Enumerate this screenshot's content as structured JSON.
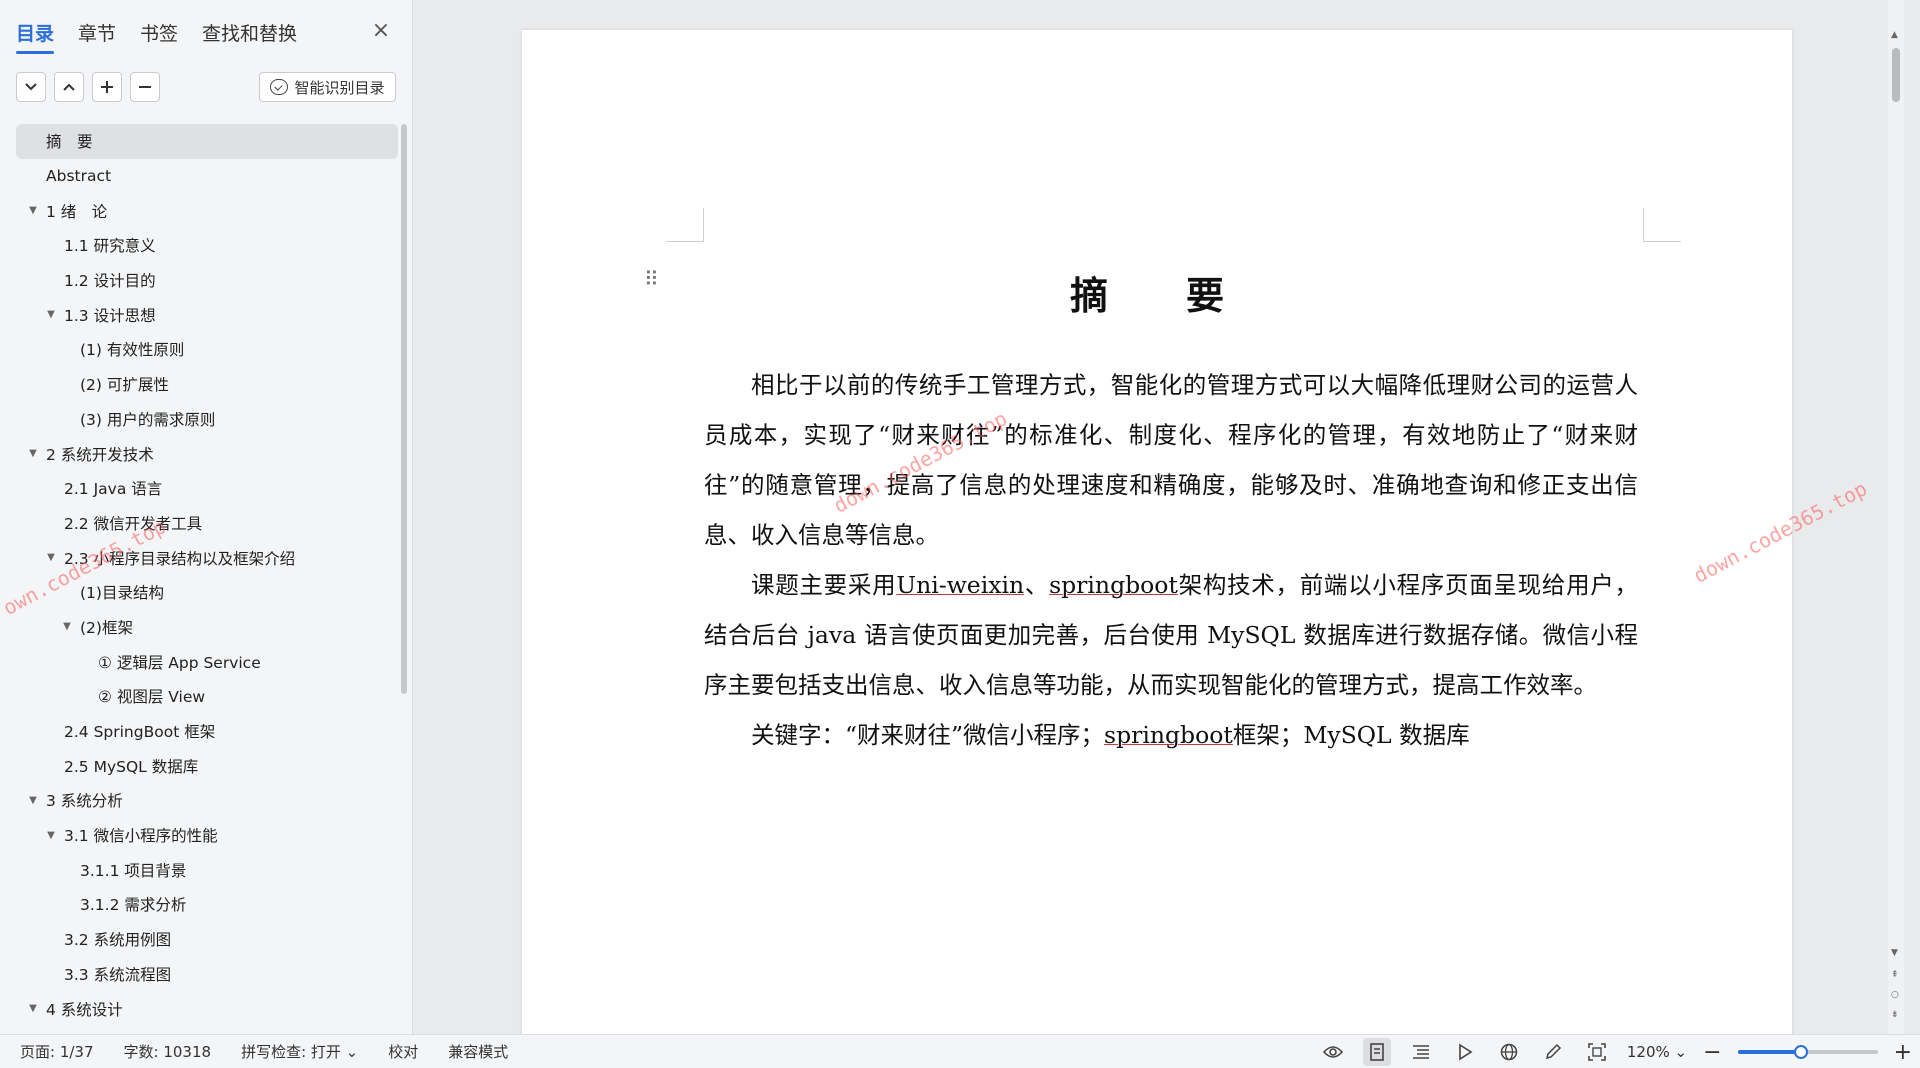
{
  "sidebar": {
    "tabs": [
      {
        "label": "目录",
        "active": true
      },
      {
        "label": "章节",
        "active": false
      },
      {
        "label": "书签",
        "active": false
      },
      {
        "label": "查找和替换",
        "active": false
      }
    ],
    "close_label": "×",
    "smart_button_label": "智能识别目录",
    "toc": [
      {
        "label": "摘　要",
        "level": 1,
        "arrow": "",
        "selected": true
      },
      {
        "label": "Abstract",
        "level": 1,
        "arrow": ""
      },
      {
        "label": "1 绪　论",
        "level": 1,
        "arrow": "▼"
      },
      {
        "label": "1.1 研究意义",
        "level": 2,
        "arrow": ""
      },
      {
        "label": "1.2 设计目的",
        "level": 2,
        "arrow": ""
      },
      {
        "label": "1.3 设计思想",
        "level": 2,
        "arrow": "▼"
      },
      {
        "label": "(1)  有效性原则",
        "level": 3,
        "arrow": ""
      },
      {
        "label": "(2)  可扩展性",
        "level": 3,
        "arrow": ""
      },
      {
        "label": "(3)  用户的需求原则",
        "level": 3,
        "arrow": ""
      },
      {
        "label": "2 系统开发技术",
        "level": 1,
        "arrow": "▼"
      },
      {
        "label": "2.1 Java 语言",
        "level": 2,
        "arrow": ""
      },
      {
        "label": "2.2 微信开发者工具",
        "level": 2,
        "arrow": ""
      },
      {
        "label": "2.3 小程序目录结构以及框架介绍",
        "level": 2,
        "arrow": "▼"
      },
      {
        "label": "(1)目录结构",
        "level": 3,
        "arrow": ""
      },
      {
        "label": "(2)框架",
        "level": 3,
        "arrow": "▼"
      },
      {
        "label": "①  逻辑层 App Service",
        "level": 4,
        "arrow": ""
      },
      {
        "label": "②  视图层 View",
        "level": 4,
        "arrow": ""
      },
      {
        "label": "2.4 SpringBoot 框架",
        "level": 2,
        "arrow": ""
      },
      {
        "label": "2.5 MySQL 数据库",
        "level": 2,
        "arrow": ""
      },
      {
        "label": "3 系统分析",
        "level": 1,
        "arrow": "▼"
      },
      {
        "label": "3.1 微信小程序的性能",
        "level": 2,
        "arrow": "▼"
      },
      {
        "label": "3.1.1 项目背景",
        "level": 3,
        "arrow": ""
      },
      {
        "label": "3.1.2 需求分析",
        "level": 3,
        "arrow": ""
      },
      {
        "label": "3.2 系统用例图",
        "level": 2,
        "arrow": ""
      },
      {
        "label": "3.3  系统流程图",
        "level": 2,
        "arrow": ""
      },
      {
        "label": "4  系统设计",
        "level": 1,
        "arrow": "▼"
      }
    ]
  },
  "document": {
    "title": "摘　要",
    "paragraphs": {
      "p1": "相比于以前的传统手工管理方式，智能化的管理方式可以大幅降低理财公司的运营人员成本，实现了“财来财往”的标准化、制度化、程序化的管理，有效地防止了“财来财往”的随意管理，提高了信息的处理速度和精确度，能够及时、准确地查询和修正支出信息、收入信息等信息。",
      "p2_a": "课题主要采用",
      "p2_u1": "Uni-weixin",
      "p2_b": "、",
      "p2_u2": "springboot",
      "p2_c": "架构技术，前端以小程序页面呈现给用户，结合后台 java 语言使页面更加完善，后台使用 MySQL 数据库进行数据存储。微信小程序主要包括支出信息、收入信息等功能，从而实现智能化的管理方式，提高工作效率。",
      "kw_label": "关键字：",
      "kw_a": "“财来财往”微信小程序；",
      "kw_u": "springboot",
      "kw_b": "框架；MySQL 数据库"
    },
    "watermarks": [
      "down.code365.top",
      "down.code365.top",
      "own.code365.top"
    ]
  },
  "statusbar": {
    "page": "页面: 1/37",
    "words": "字数: 10318",
    "spellcheck": "拼写检查: 打开 ⌄",
    "proofread": "校对",
    "compat": "兼容模式",
    "zoom": "120% ⌄",
    "zoom_fraction": 0.45
  }
}
